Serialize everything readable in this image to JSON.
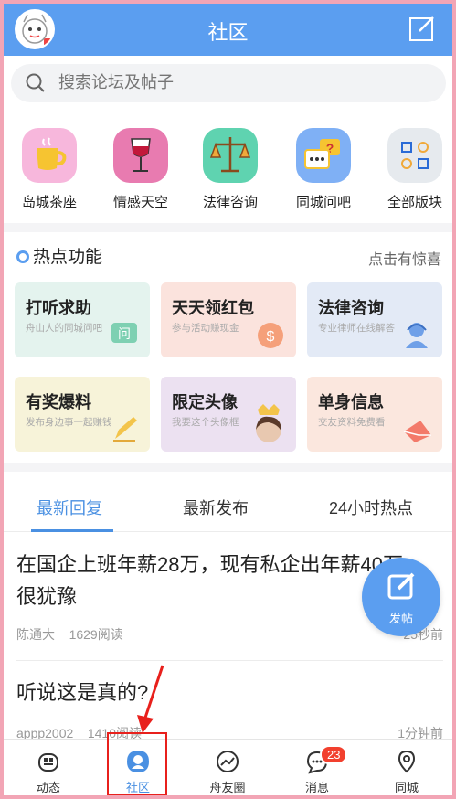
{
  "header": {
    "title": "社区"
  },
  "search": {
    "placeholder": "搜索论坛及帖子"
  },
  "forums": [
    {
      "label": "岛城茶座",
      "icon": "tea-cup-icon",
      "color": "#f7b7dc"
    },
    {
      "label": "情感天空",
      "icon": "wine-glass-icon",
      "color": "#e87bb0"
    },
    {
      "label": "法律咨询",
      "icon": "scales-icon",
      "color": "#5fd3b0"
    },
    {
      "label": "同城问吧",
      "icon": "chat-bubbles-icon",
      "color": "#7fb0f5"
    },
    {
      "label": "全部版块",
      "icon": "grid-icon",
      "color": "#e6eaee"
    }
  ],
  "hot": {
    "title": "热点功能",
    "more": "点击有惊喜",
    "cards": [
      {
        "title": "打听求助",
        "sub": "舟山人的同城问吧",
        "icon": "question-icon",
        "bg": "#e4f3ee"
      },
      {
        "title": "天天领红包",
        "sub": "参与活动赚现金",
        "icon": "money-icon",
        "bg": "#fbe3dd"
      },
      {
        "title": "法律咨询",
        "sub": "专业律师在线解答",
        "icon": "lawyer-icon",
        "bg": "#e3eaf6"
      },
      {
        "title": "有奖爆料",
        "sub": "发布身边事一起赚钱",
        "icon": "pencil-icon",
        "bg": "#f7f3d9"
      },
      {
        "title": "限定头像",
        "sub": "我要这个头像框",
        "icon": "avatar-frame-icon",
        "bg": "#ece1f1"
      },
      {
        "title": "单身信息",
        "sub": "交友资料免费看",
        "icon": "envelope-icon",
        "bg": "#fbe7de"
      }
    ]
  },
  "tabs": [
    "最新回复",
    "最新发布",
    "24小时热点"
  ],
  "posts": [
    {
      "title": "在国企上班年薪28万，现有私企出年薪40万，很犹豫",
      "author": "陈通大",
      "reads": "1629阅读",
      "time": "25秒前"
    },
    {
      "title": "听说这是真的?",
      "author": "appp2002",
      "reads": "1410阅读",
      "time": "1分钟前"
    }
  ],
  "fab": {
    "label": "发帖"
  },
  "nav": [
    {
      "label": "动态",
      "icon": "dynamic-icon"
    },
    {
      "label": "社区",
      "icon": "community-icon"
    },
    {
      "label": "舟友圈",
      "icon": "circle-icon"
    },
    {
      "label": "消息",
      "icon": "message-icon",
      "badge": "23"
    },
    {
      "label": "同城",
      "icon": "location-icon"
    }
  ]
}
